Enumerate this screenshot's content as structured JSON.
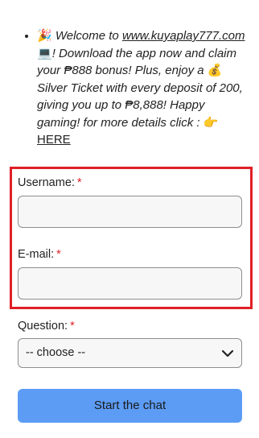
{
  "promo": {
    "prefix_emoji": "🎉",
    "welcome": "Welcome to",
    "link": "www.kuyaplay777.com",
    "link_emoji": "💻",
    "after_link": "!",
    "body": "Download the app now and claim your ₱888 bonus!  Plus, enjoy a",
    "bag_emoji": "💰",
    "body2": "Silver Ticket with every deposit of 200, giving you up to ₱8,888!  Happy gaming!  for more details click :",
    "point_emoji": "👉",
    "here_link": "HERE"
  },
  "form": {
    "username_label": "Username:",
    "email_label": "E-mail:",
    "question_label": "Question:",
    "required_mark": "*",
    "username_value": "",
    "email_value": "",
    "question_selected": "-- choose --",
    "submit_label": "Start the chat"
  },
  "colors": {
    "highlight_border": "#e01f26",
    "button_bg": "#5c9cf5",
    "required": "#e01f26"
  }
}
